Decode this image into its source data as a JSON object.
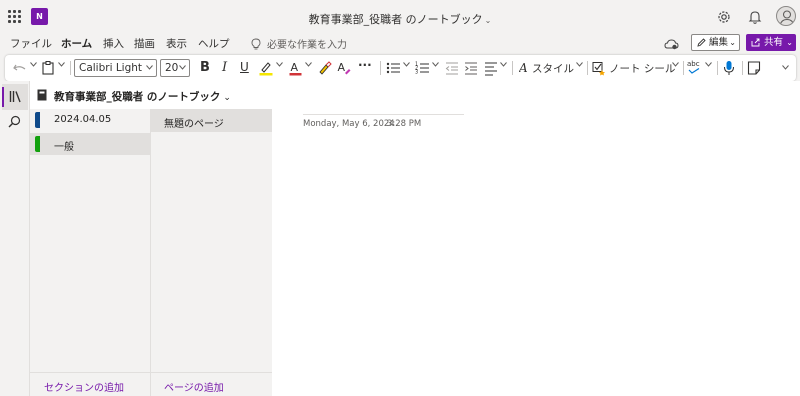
{
  "app": {
    "logo_letter": "N",
    "title": "教育事業部_役職者 のノートブック",
    "title_chevron": "⌄"
  },
  "ribbon": {
    "tabs": [
      {
        "label": "ファイル"
      },
      {
        "label": "ホーム"
      },
      {
        "label": "挿入"
      },
      {
        "label": "描画"
      },
      {
        "label": "表示"
      },
      {
        "label": "ヘルプ"
      }
    ],
    "active_tab": "ホーム",
    "tell_me": "必要な作業を入力",
    "edit_label": "編集",
    "share_label": "共有"
  },
  "toolbar": {
    "font_name": "Calibri Light",
    "font_size": "20",
    "bold": "B",
    "italic": "I",
    "underline": "U",
    "more": "···",
    "styles_label": "スタイル",
    "tags_label": "ノート シール",
    "spelling_label": "abc",
    "font_color_letter": "A",
    "highlight_color": "#f5e600",
    "font_color": "#d13438"
  },
  "notebook": {
    "title": "教育事業部_役職者 のノートブック",
    "sections": [
      {
        "label": "2024.04.05",
        "color": "#0f4a8a"
      },
      {
        "label": "一般",
        "color": "#13a10e"
      }
    ],
    "selected_section": "一般",
    "add_section": "セクションの追加"
  },
  "pages": {
    "items": [
      {
        "label": "無題のページ"
      }
    ],
    "add_page": "ページの追加"
  },
  "canvas": {
    "date": "Monday, May 6, 2024",
    "time": "3:28 PM"
  },
  "colors": {
    "accent": "#7719aa",
    "chrome": "#f3f2f1"
  }
}
